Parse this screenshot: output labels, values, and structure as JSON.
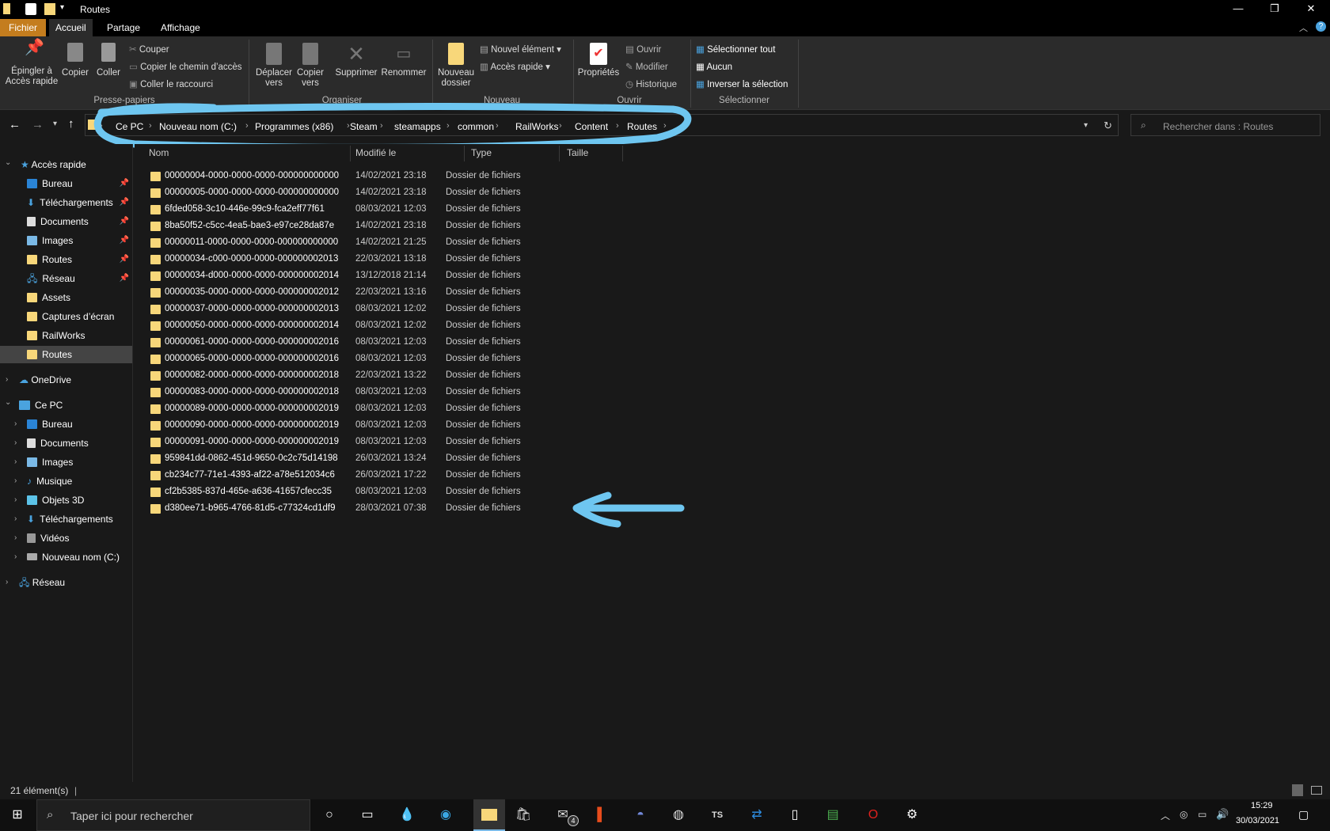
{
  "window": {
    "title": "Routes"
  },
  "tabs": [
    {
      "label": "Fichier"
    },
    {
      "label": "Accueil"
    },
    {
      "label": "Partage"
    },
    {
      "label": "Affichage"
    }
  ],
  "ribbon": {
    "pin": "Épingler à\nAccès rapide",
    "copy": "Copier",
    "paste": "Coller",
    "cut": "Couper",
    "copy_path": "Copier le chemin d’accès",
    "paste_shortcut": "Coller le raccourci",
    "group_clipboard": "Presse-papiers",
    "move_to": "Déplacer\nvers",
    "copy_to": "Copier\nvers",
    "delete": "Supprimer",
    "rename": "Renommer",
    "group_organize": "Organiser",
    "new_folder": "Nouveau\ndossier",
    "new_item": "Nouvel élément",
    "quick_access": "Accès rapide",
    "group_new": "Nouveau",
    "properties": "Propriétés",
    "open": "Ouvrir",
    "edit": "Modifier",
    "history": "Historique",
    "group_open": "Ouvrir",
    "select_all": "Sélectionner tout",
    "select_none": "Aucun",
    "invert_selection": "Inverser la sélection",
    "group_select": "Sélectionner"
  },
  "address": {
    "crumbs": [
      "Ce PC",
      "Nouveau nom (C:)",
      "Programmes (x86)",
      "Steam",
      "steamapps",
      "common",
      "RailWorks",
      "Content",
      "Routes"
    ],
    "search_placeholder": "Rechercher dans : Routes"
  },
  "nav": {
    "quick_access": "Accès rapide",
    "quick_items": [
      "Bureau",
      "Téléchargements",
      "Documents",
      "Images",
      "Routes",
      "Réseau",
      "Assets",
      "Captures d’écran",
      "RailWorks",
      "Routes"
    ],
    "onedrive": "OneDrive",
    "this_pc": "Ce PC",
    "pc_items": [
      "Bureau",
      "Documents",
      "Images",
      "Musique",
      "Objets 3D",
      "Téléchargements",
      "Vidéos",
      "Nouveau nom (C:)"
    ],
    "network": "Réseau"
  },
  "columns": {
    "name": "Nom",
    "modified": "Modifié le",
    "type": "Type",
    "size": "Taille"
  },
  "files": [
    {
      "name": "00000004-0000-0000-0000-000000000000",
      "date": "14/02/2021 23:18",
      "type": "Dossier de fichiers"
    },
    {
      "name": "00000005-0000-0000-0000-000000000000",
      "date": "14/02/2021 23:18",
      "type": "Dossier de fichiers"
    },
    {
      "name": "6fded058-3c10-446e-99c9-fca2eff77f61",
      "date": "08/03/2021 12:03",
      "type": "Dossier de fichiers"
    },
    {
      "name": "8ba50f52-c5cc-4ea5-bae3-e97ce28da87e",
      "date": "14/02/2021 23:18",
      "type": "Dossier de fichiers"
    },
    {
      "name": "00000011-0000-0000-0000-000000000000",
      "date": "14/02/2021 21:25",
      "type": "Dossier de fichiers"
    },
    {
      "name": "00000034-c000-0000-0000-000000002013",
      "date": "22/03/2021 13:18",
      "type": "Dossier de fichiers"
    },
    {
      "name": "00000034-d000-0000-0000-000000002014",
      "date": "13/12/2018 21:14",
      "type": "Dossier de fichiers"
    },
    {
      "name": "00000035-0000-0000-0000-000000002012",
      "date": "22/03/2021 13:16",
      "type": "Dossier de fichiers"
    },
    {
      "name": "00000037-0000-0000-0000-000000002013",
      "date": "08/03/2021 12:02",
      "type": "Dossier de fichiers"
    },
    {
      "name": "00000050-0000-0000-0000-000000002014",
      "date": "08/03/2021 12:02",
      "type": "Dossier de fichiers"
    },
    {
      "name": "00000061-0000-0000-0000-000000002016",
      "date": "08/03/2021 12:03",
      "type": "Dossier de fichiers"
    },
    {
      "name": "00000065-0000-0000-0000-000000002016",
      "date": "08/03/2021 12:03",
      "type": "Dossier de fichiers"
    },
    {
      "name": "00000082-0000-0000-0000-000000002018",
      "date": "22/03/2021 13:22",
      "type": "Dossier de fichiers"
    },
    {
      "name": "00000083-0000-0000-0000-000000002018",
      "date": "08/03/2021 12:03",
      "type": "Dossier de fichiers"
    },
    {
      "name": "00000089-0000-0000-0000-000000002019",
      "date": "08/03/2021 12:03",
      "type": "Dossier de fichiers"
    },
    {
      "name": "00000090-0000-0000-0000-000000002019",
      "date": "08/03/2021 12:03",
      "type": "Dossier de fichiers"
    },
    {
      "name": "00000091-0000-0000-0000-000000002019",
      "date": "08/03/2021 12:03",
      "type": "Dossier de fichiers"
    },
    {
      "name": "959841dd-0862-451d-9650-0c2c75d14198",
      "date": "26/03/2021 13:24",
      "type": "Dossier de fichiers"
    },
    {
      "name": "cb234c77-71e1-4393-af22-a78e512034c6",
      "date": "26/03/2021 17:22",
      "type": "Dossier de fichiers"
    },
    {
      "name": "cf2b5385-837d-465e-a636-41657cfecc35",
      "date": "08/03/2021 12:03",
      "type": "Dossier de fichiers"
    },
    {
      "name": "d380ee71-b965-4766-81d5-c77324cd1df9",
      "date": "28/03/2021 07:38",
      "type": "Dossier de fichiers"
    }
  ],
  "status": {
    "count": "21 élément(s)"
  },
  "taskbar": {
    "search_placeholder": "Taper ici pour rechercher",
    "mail_badge": "4",
    "time": "15:29",
    "date": "30/03/2021"
  },
  "colors": {
    "folder": "#f8d77a",
    "accent_tab": "#c47d1e",
    "annotation": "#6ec6f0"
  }
}
